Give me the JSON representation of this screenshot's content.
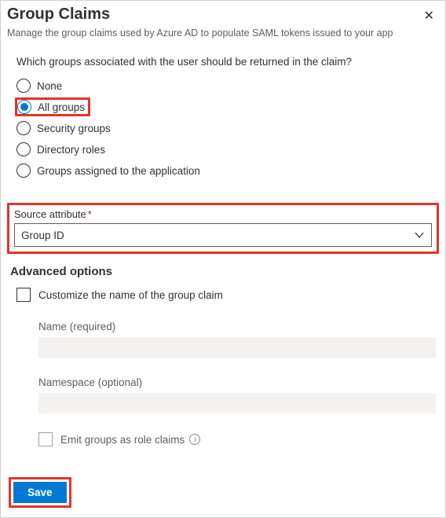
{
  "header": {
    "title": "Group Claims",
    "subtitle": "Manage the group claims used by Azure AD to populate SAML tokens issued to your app"
  },
  "question": "Which groups associated with the user should be returned in the claim?",
  "radios": {
    "none": "None",
    "all": "All groups",
    "security": "Security groups",
    "directory": "Directory roles",
    "assigned": "Groups assigned to the application"
  },
  "source": {
    "label": "Source attribute",
    "required_mark": "*",
    "value": "Group ID"
  },
  "advanced": {
    "title": "Advanced options",
    "customize_label": "Customize the name of the group claim",
    "name_label": "Name (required)",
    "namespace_label": "Namespace (optional)",
    "emit_label": "Emit groups as role claims"
  },
  "buttons": {
    "save": "Save"
  }
}
